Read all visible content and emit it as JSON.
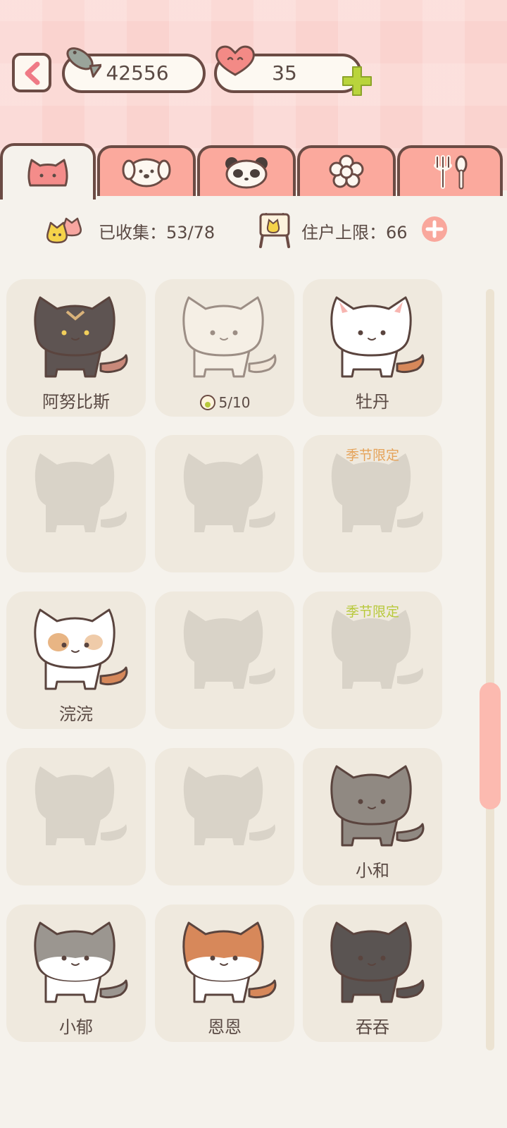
{
  "header": {
    "fish_count": "42556",
    "heart_count": "35",
    "icons": {
      "back": "back-arrow-icon",
      "fish": "fish-icon",
      "heart": "heart-icon",
      "add": "plus-icon"
    }
  },
  "tabs": [
    {
      "id": "cats",
      "icon": "cat-face-icon",
      "active": true
    },
    {
      "id": "dogs",
      "icon": "dog-face-icon",
      "active": false
    },
    {
      "id": "pandas",
      "icon": "panda-face-icon",
      "active": false
    },
    {
      "id": "flowers",
      "icon": "flower-icon",
      "active": false
    },
    {
      "id": "food",
      "icon": "fork-spoon-icon",
      "active": false
    }
  ],
  "stats": {
    "collected_label": "已收集：53/78",
    "capacity_label": "住户上限：66"
  },
  "season_label": "季节限定",
  "colors": {
    "accent": "#fba99d",
    "header_bg": "#fad3cf",
    "season_orange": "#e5a35a",
    "season_green": "#b8c93c",
    "card_bg": "#efe9de"
  },
  "cats": [
    {
      "name": "阿努比斯",
      "state": "owned",
      "variant": "dark"
    },
    {
      "name": "",
      "state": "progress",
      "progress": "5/10",
      "variant": "faded"
    },
    {
      "name": "牡丹",
      "state": "owned",
      "variant": "white"
    },
    {
      "name": "",
      "state": "locked"
    },
    {
      "name": "",
      "state": "locked"
    },
    {
      "name": "",
      "state": "locked",
      "season": "orange"
    },
    {
      "name": "浣浣",
      "state": "owned",
      "variant": "calico"
    },
    {
      "name": "",
      "state": "locked"
    },
    {
      "name": "",
      "state": "locked",
      "season": "green"
    },
    {
      "name": "",
      "state": "locked"
    },
    {
      "name": "",
      "state": "locked"
    },
    {
      "name": "小和",
      "state": "owned",
      "variant": "gray"
    },
    {
      "name": "小郁",
      "state": "owned",
      "variant": "graywhite"
    },
    {
      "name": "恩恩",
      "state": "owned",
      "variant": "orangewhite"
    },
    {
      "name": "吞吞",
      "state": "owned",
      "variant": "charcoal"
    }
  ]
}
